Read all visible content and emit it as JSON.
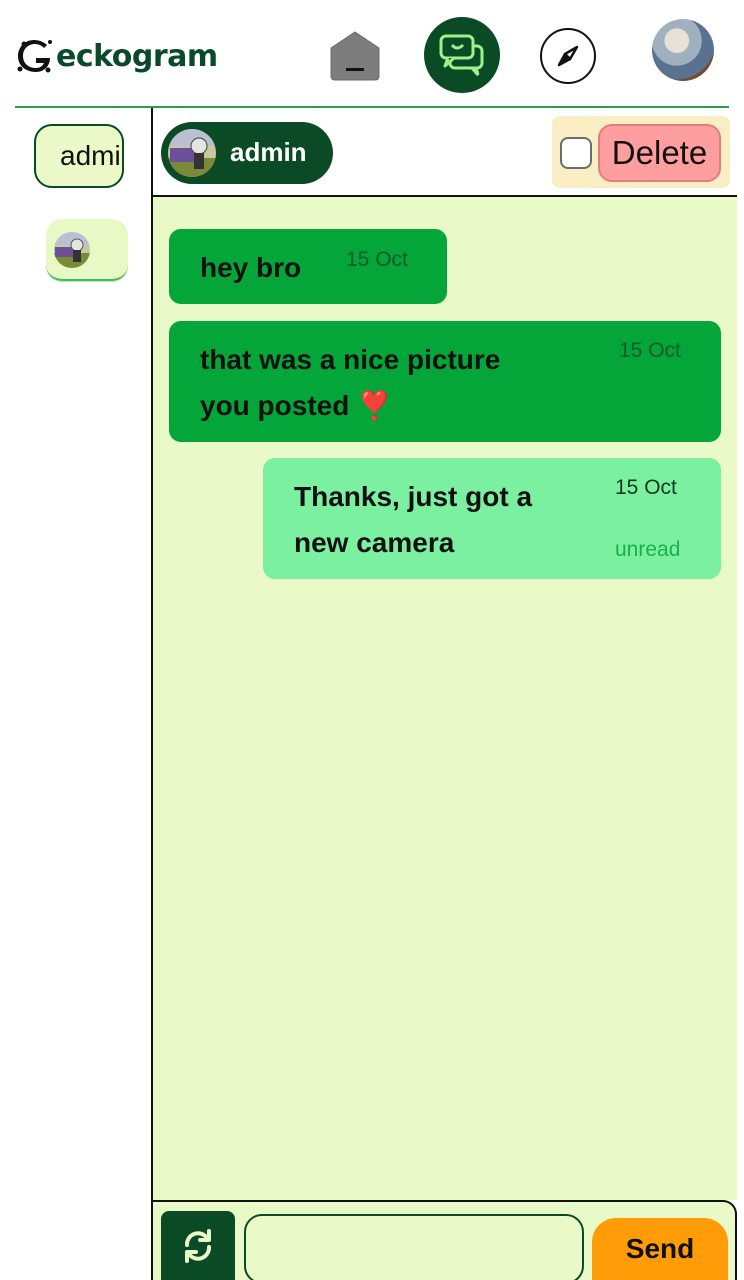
{
  "app": {
    "title": "Geckogram",
    "logo_rest": "eckogram"
  },
  "nav": {
    "items": [
      {
        "name": "home",
        "icon": "house-icon"
      },
      {
        "name": "chats",
        "icon": "chat-bubbles-icon",
        "active": true
      },
      {
        "name": "explore",
        "icon": "compass-icon"
      },
      {
        "name": "profile",
        "icon": "avatar"
      }
    ]
  },
  "sidebar": {
    "search": {
      "value": "admin",
      "placeholder": ""
    },
    "contacts": [
      {
        "name": "admin",
        "icon": "avatar"
      }
    ]
  },
  "chat": {
    "user_name": "admin",
    "delete_label": "Delete",
    "messages": [
      {
        "direction": "in",
        "lines": [
          "hey bro"
        ],
        "date": "15 Oct",
        "status": ""
      },
      {
        "direction": "in",
        "lines": [
          "that was a nice picture",
          "you posted ❣️"
        ],
        "date": "15 Oct",
        "status": ""
      },
      {
        "direction": "out",
        "lines": [
          "Thanks, just got a",
          "new camera"
        ],
        "date": "15 Oct",
        "status": "unread"
      }
    ]
  },
  "composer": {
    "input_value": "",
    "placeholder": "",
    "send_label": "Send",
    "refresh_icon": "refresh-icon"
  },
  "colors": {
    "brand_dark": "#0a4a25",
    "incoming_bubble": "#04a63a",
    "outgoing_bubble": "#7bf0a1",
    "chat_background": "#e9f9c8",
    "delete_button": "#ff9e9e",
    "send_button": "#ff9c07"
  }
}
